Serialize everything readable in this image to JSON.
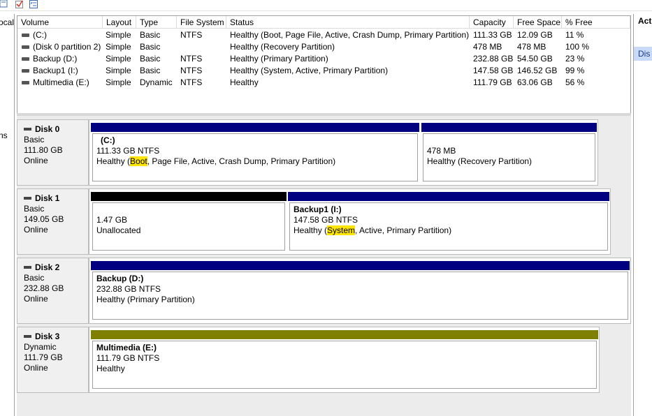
{
  "colors": {
    "primary_partition": "#000080",
    "unallocated": "#000000",
    "simple_volume": "#808000",
    "highlight": "#ffe600"
  },
  "toolbar": {
    "icons": [
      "properties-icon",
      "checkmark-icon",
      "checklist-icon"
    ]
  },
  "nav": {
    "fragment_top": "ocal",
    "fragment_mid": "ns"
  },
  "actions": {
    "header": "Act",
    "item": "Dis"
  },
  "volume_list": {
    "columns": [
      "Volume",
      "Layout",
      "Type",
      "File System",
      "Status",
      "Capacity",
      "Free Space",
      "% Free"
    ],
    "rows": [
      {
        "volume": "(C:)",
        "layout": "Simple",
        "type": "Basic",
        "fs": "NTFS",
        "status": "Healthy (Boot, Page File, Active, Crash Dump, Primary Partition)",
        "capacity": "111.33 GB",
        "free": "12.09 GB",
        "pct": "11 %"
      },
      {
        "volume": "(Disk 0 partition 2)",
        "layout": "Simple",
        "type": "Basic",
        "fs": "",
        "status": "Healthy (Recovery Partition)",
        "capacity": "478 MB",
        "free": "478 MB",
        "pct": "100 %"
      },
      {
        "volume": "Backup (D:)",
        "layout": "Simple",
        "type": "Basic",
        "fs": "NTFS",
        "status": "Healthy (Primary Partition)",
        "capacity": "232.88 GB",
        "free": "54.50 GB",
        "pct": "23 %"
      },
      {
        "volume": "Backup1 (I:)",
        "layout": "Simple",
        "type": "Basic",
        "fs": "NTFS",
        "status": "Healthy (System, Active, Primary Partition)",
        "capacity": "147.58 GB",
        "free": "146.52 GB",
        "pct": "99 %"
      },
      {
        "volume": "Multimedia (E:)",
        "layout": "Simple",
        "type": "Dynamic",
        "fs": "NTFS",
        "status": "Healthy",
        "capacity": "111.79 GB",
        "free": "63.06 GB",
        "pct": "56 %"
      }
    ]
  },
  "disks": [
    {
      "name": "Disk 0",
      "type": "Basic",
      "size": "111.80 GB",
      "state": "Online",
      "partitions": [
        {
          "name": "(C:)",
          "size_fs": "111.33 GB NTFS",
          "status_pre": "Healthy (",
          "status_hl": "Boot",
          "status_post": ", Page File, Active, Crash Dump, Primary Partition)"
        },
        {
          "name": "",
          "size_fs": "478 MB",
          "status_pre": "Healthy (Recovery Partition)",
          "status_hl": "",
          "status_post": ""
        }
      ]
    },
    {
      "name": "Disk 1",
      "type": "Basic",
      "size": "149.05 GB",
      "state": "Online",
      "partitions": [
        {
          "name": "",
          "size_fs": "1.47 GB",
          "status_pre": "Unallocated",
          "status_hl": "",
          "status_post": ""
        },
        {
          "name": "Backup1  (I:)",
          "size_fs": "147.58 GB NTFS",
          "status_pre": "Healthy (",
          "status_hl": "System",
          "status_post": ", Active, Primary Partition)"
        }
      ]
    },
    {
      "name": "Disk 2",
      "type": "Basic",
      "size": "232.88 GB",
      "state": "Online",
      "partitions": [
        {
          "name": "Backup  (D:)",
          "size_fs": "232.88 GB NTFS",
          "status_pre": "Healthy (Primary Partition)",
          "status_hl": "",
          "status_post": ""
        }
      ]
    },
    {
      "name": "Disk 3",
      "type": "Dynamic",
      "size": "111.79 GB",
      "state": "Online",
      "partitions": [
        {
          "name": "Multimedia  (E:)",
          "size_fs": "111.79 GB NTFS",
          "status_pre": "Healthy",
          "status_hl": "",
          "status_post": ""
        }
      ]
    }
  ]
}
